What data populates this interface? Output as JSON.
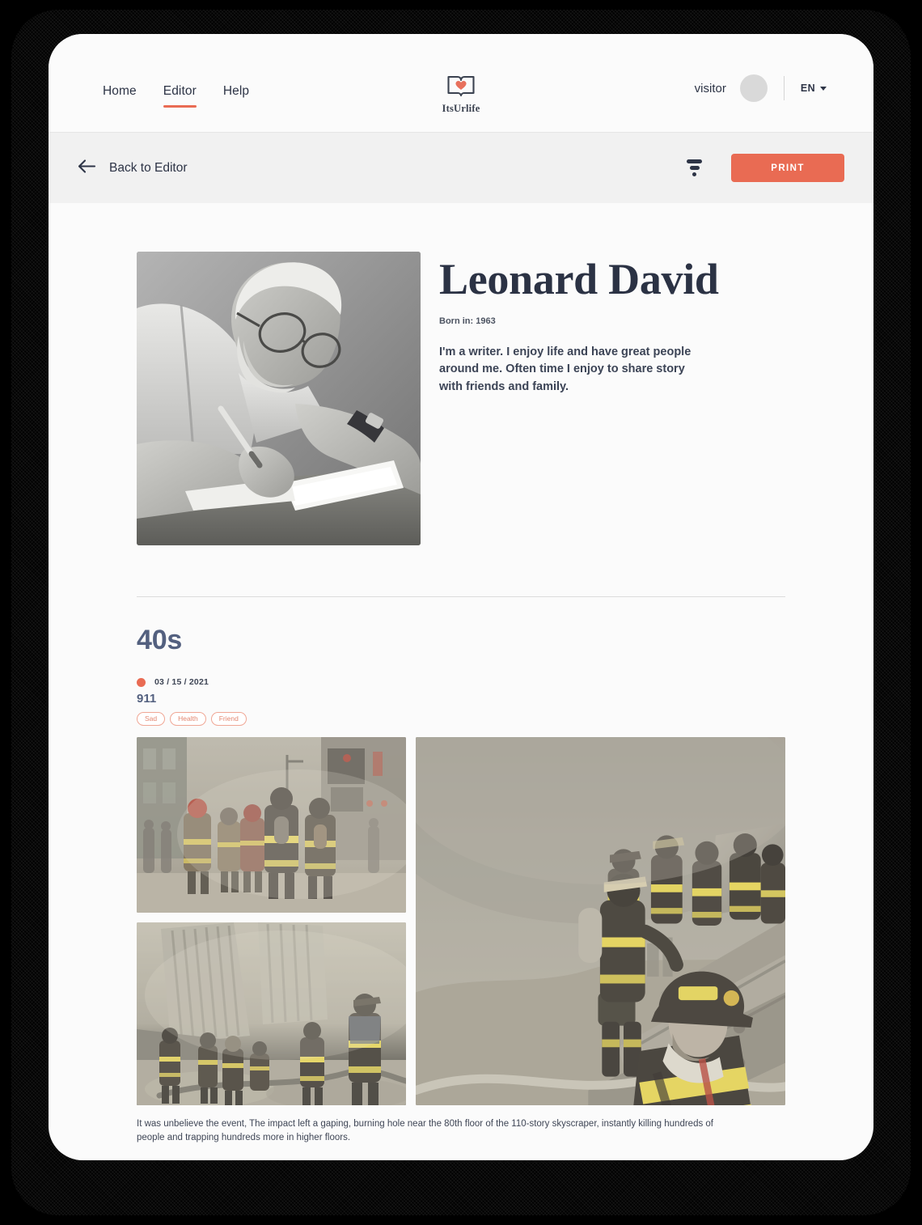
{
  "nav": {
    "items": [
      {
        "label": "Home",
        "active": false
      },
      {
        "label": "Editor",
        "active": true
      },
      {
        "label": "Help",
        "active": false
      }
    ]
  },
  "brand": {
    "name": "ItsUrlife",
    "mark_icon": "book-heart-icon",
    "heart_color": "#e8705c",
    "outline_color": "#3b4250"
  },
  "account": {
    "user": "visitor",
    "avatar_icon": "user-avatar",
    "language": "EN",
    "caret_icon": "chevron-down-icon"
  },
  "toolbar": {
    "back_label": "Back to Editor",
    "back_icon": "arrow-left-icon",
    "filter_icon": "filter-icon",
    "print_label": "PRINT",
    "accent_color": "#e96b53"
  },
  "profile": {
    "portrait_alt": "Black and white photo of a bearded man with glasses writing in a notebook",
    "name": "Leonard David",
    "born_label": "Born in: 1963",
    "bio": "I'm a writer. I enjoy life and have great people around me. Often time I enjoy to share story with friends and family."
  },
  "section": {
    "decade": "40s",
    "entry": {
      "date": "03 / 15 / 2021",
      "title": "911",
      "tags": [
        "Sad",
        "Health",
        "Friend"
      ],
      "caption": "It was unbelieve the event, The impact left a gaping, burning hole near the 80th floor of the 110-story skyscraper, instantly killing hundreds of people and trapping hundreds more in higher floors.",
      "photos": [
        {
          "alt": "Firefighters walking through a dust-filled city street"
        },
        {
          "alt": "Firefighters with hoses amid rubble near the damaged tower facade"
        },
        {
          "alt": "Firefighters climbing over steel debris in heavy smoke"
        }
      ]
    }
  }
}
